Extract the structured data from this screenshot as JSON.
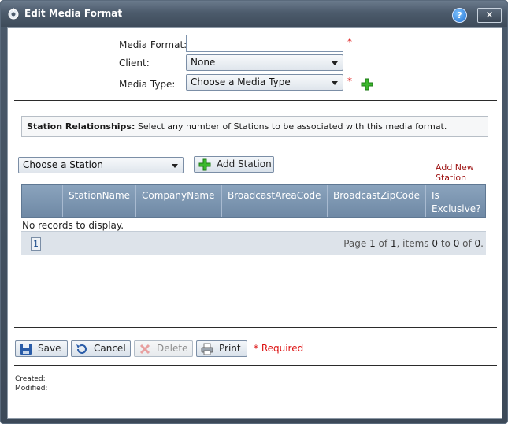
{
  "window": {
    "title": "Edit Media Format",
    "help_label": "?",
    "close_label": "✕"
  },
  "form": {
    "media_format_label": "Media Format:",
    "media_format_value": "",
    "client_label": "Client:",
    "client_value": "None",
    "media_type_label": "Media Type:",
    "media_type_value": "Choose a Media Type",
    "required_mark": "*"
  },
  "station_relationships": {
    "title": "Station Relationships:",
    "description": " Select any number of Stations to be associated with this media format."
  },
  "station_picker": {
    "value": "Choose a Station",
    "add_button": "Add Station",
    "add_new_link": "Add New Station"
  },
  "grid": {
    "columns": [
      "StationName",
      "CompanyName",
      "BroadcastAreaCode",
      "BroadcastZipCode",
      "Is Exclusive?"
    ],
    "empty_text": "No records to display.",
    "pager": {
      "current_page": "1",
      "info_prefix": "Page ",
      "page": "1",
      "of": " of ",
      "pages": "1",
      "items_text": ", items ",
      "from": "0",
      "to_text": " to ",
      "to": "0",
      "of2": " of ",
      "total": "0",
      "end": "."
    }
  },
  "actions": {
    "save": "Save",
    "cancel": "Cancel",
    "delete": "Delete",
    "print": "Print",
    "required_note": "* Required"
  },
  "meta": {
    "created_label": "Created:",
    "modified_label": "Modified:"
  },
  "colors": {
    "title_bar": "#4c5b6c",
    "grid_header": "#7b94b0",
    "required_red": "#dd1111",
    "link_red": "#a01818"
  }
}
